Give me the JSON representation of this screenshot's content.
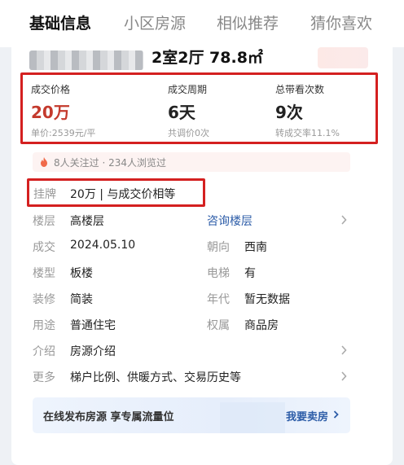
{
  "tabs": [
    {
      "label": "基础信息",
      "active": true
    },
    {
      "label": "小区房源",
      "active": false
    },
    {
      "label": "相似推荐",
      "active": false
    },
    {
      "label": "猜你喜欢",
      "active": false
    }
  ],
  "house": {
    "title": "2室2厅 78.8㎡"
  },
  "deal": [
    {
      "label": "成交价格",
      "value": "20万",
      "sub": "单价:2539元/平"
    },
    {
      "label": "成交周期",
      "value": "6天",
      "sub": "共调价0次"
    },
    {
      "label": "总带看次数",
      "value": "9次",
      "sub": "转成交率11.1%"
    }
  ],
  "attention": {
    "text": "8人关注过 · 234人浏览过"
  },
  "listing": {
    "label": "挂牌",
    "value": "20万 | 与成交价相等"
  },
  "rows": {
    "floor": {
      "label": "楼层",
      "value": "高楼层",
      "link": "咨询楼层"
    },
    "deal_date": {
      "label": "成交",
      "value": "2024.05.10"
    },
    "orientation": {
      "label": "朝向",
      "value": "西南"
    },
    "building_type": {
      "label": "楼型",
      "value": "板楼"
    },
    "elevator": {
      "label": "电梯",
      "value": "有"
    },
    "decoration": {
      "label": "装修",
      "value": "简装"
    },
    "year": {
      "label": "年代",
      "value": "暂无数据"
    },
    "usage": {
      "label": "用途",
      "value": "普通住宅"
    },
    "ownership": {
      "label": "权属",
      "value": "商品房"
    },
    "intro": {
      "label": "介绍",
      "value": "房源介绍"
    },
    "more": {
      "label": "更多",
      "value": "梯户比例、供暖方式、交易历史等"
    }
  },
  "banner": {
    "text": "在线发布房源 享专属流量位",
    "link": "我要卖房"
  },
  "colors": {
    "accent_red": "#c43a2d",
    "link_blue": "#2d5da8",
    "highlight_border": "#d42020"
  }
}
